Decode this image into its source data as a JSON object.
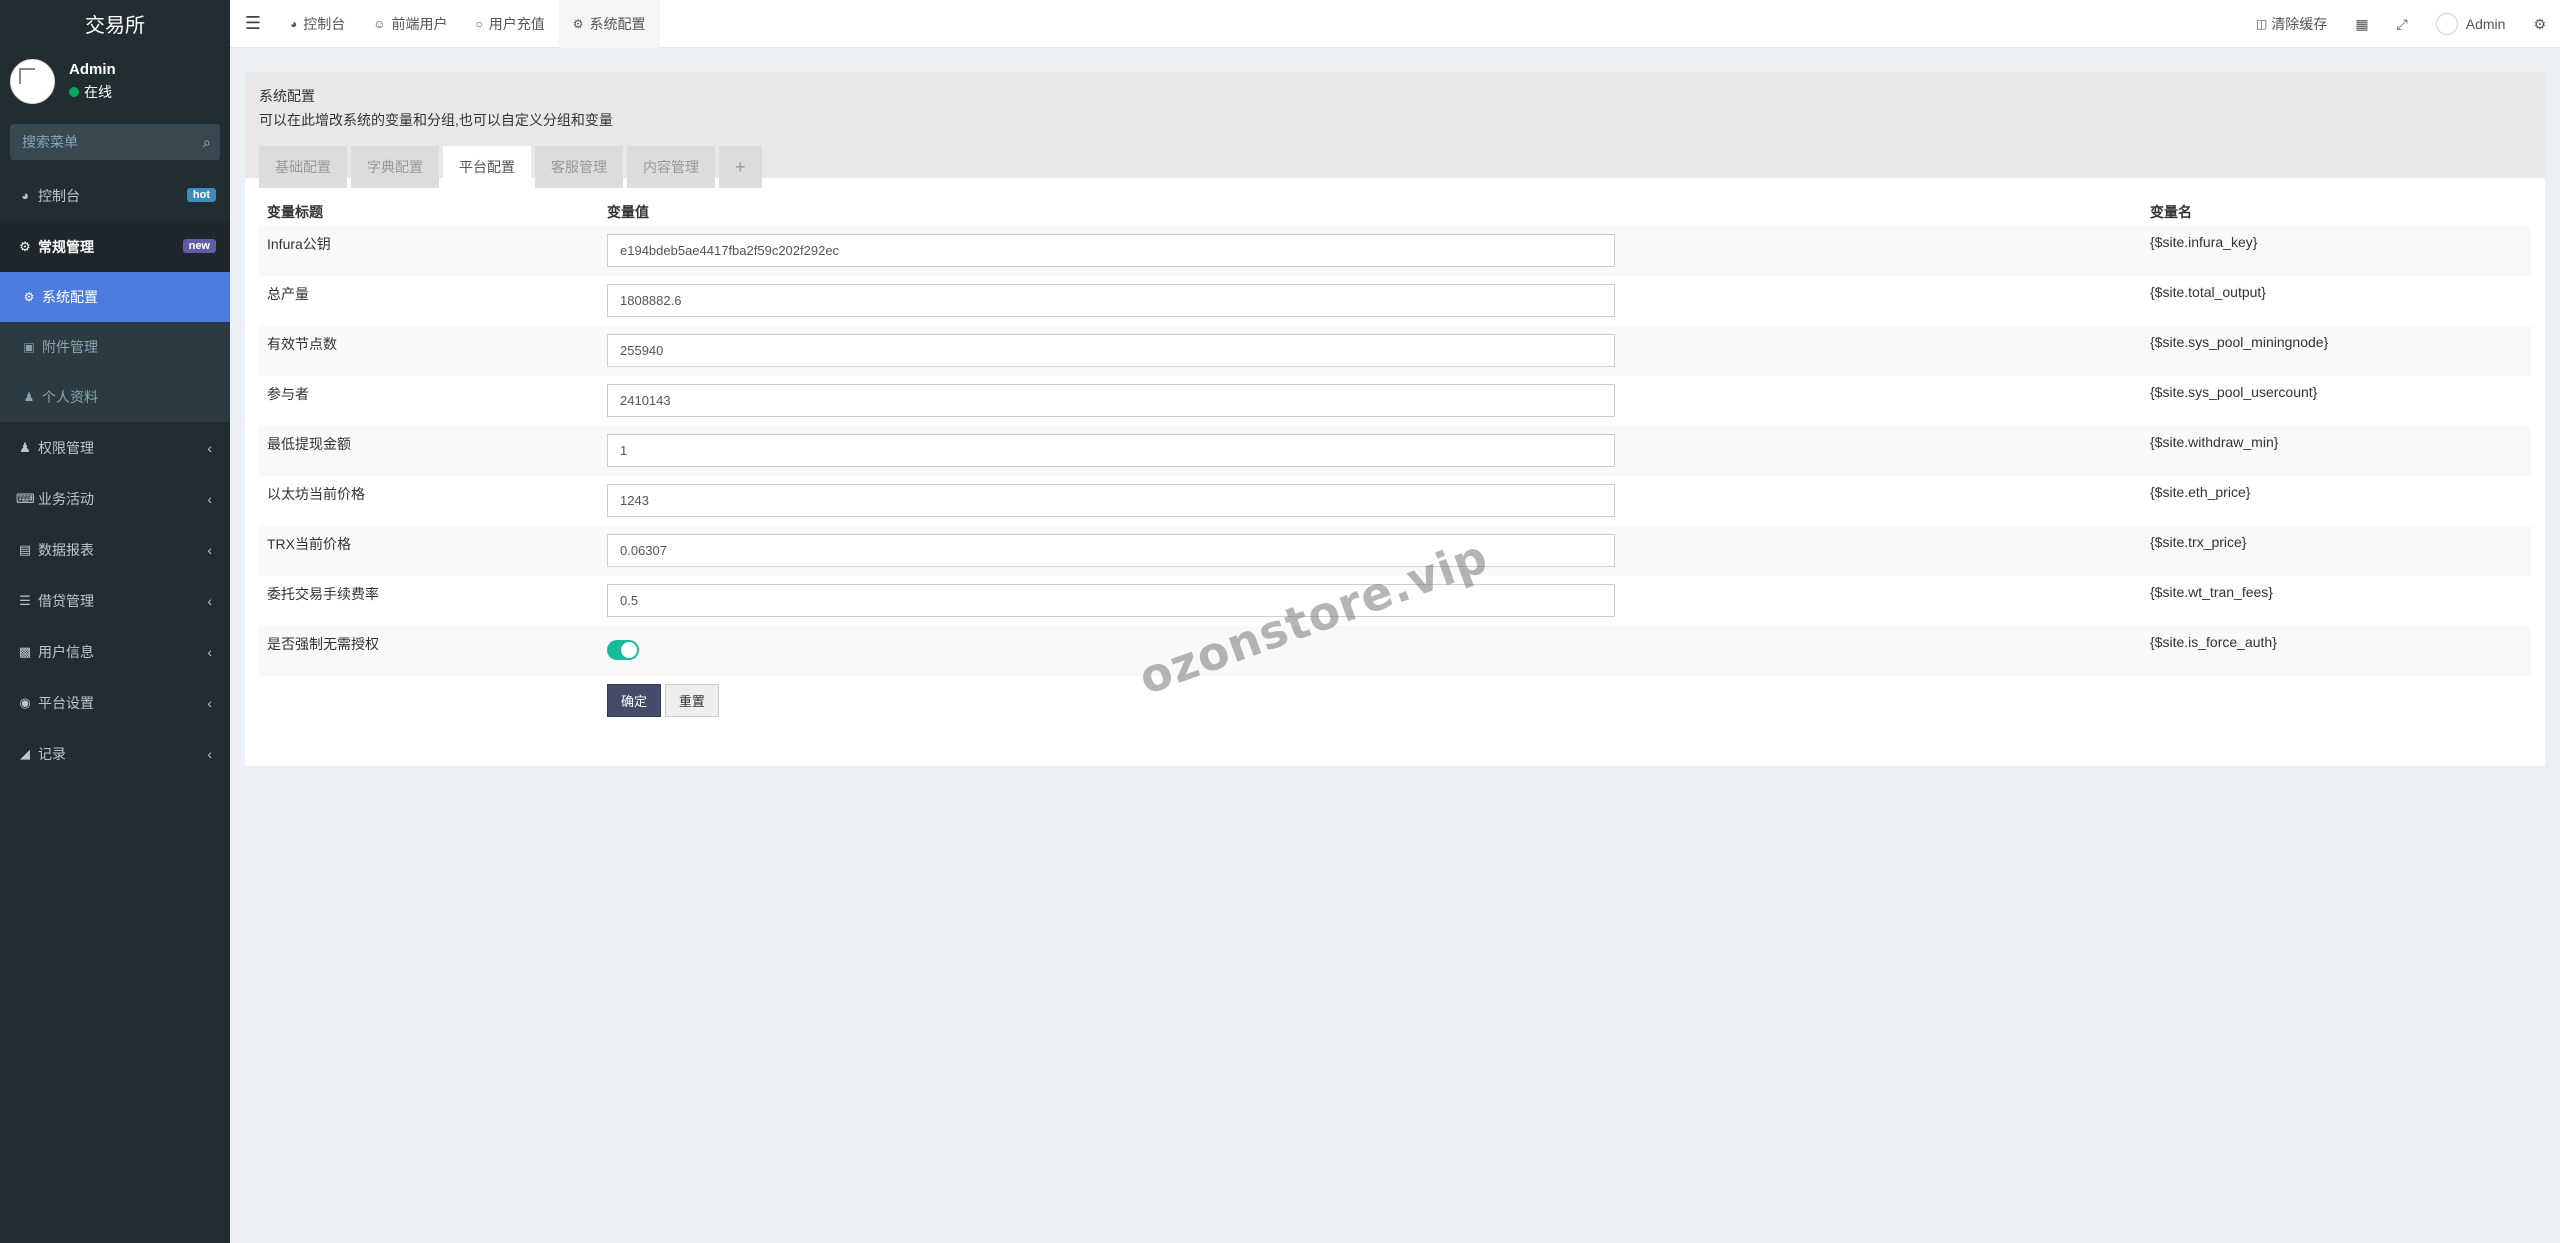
{
  "sidebar": {
    "logo": "交易所",
    "user": {
      "name": "Admin",
      "status": "在线"
    },
    "search_placeholder": "搜索菜单",
    "nav": [
      {
        "label": "控制台",
        "badge": "hot",
        "icon": "dashboard-icon"
      },
      {
        "label": "常规管理",
        "badge": "new",
        "icon": "cogs-icon"
      },
      {
        "label": "权限管理",
        "icon": "group-icon"
      },
      {
        "label": "业务活动",
        "icon": "keyboard-icon"
      },
      {
        "label": "数据报表",
        "icon": "file-icon"
      },
      {
        "label": "借贷管理",
        "icon": "list-icon"
      },
      {
        "label": "用户信息",
        "icon": "address-book-icon"
      },
      {
        "label": "平台设置",
        "icon": "settings-icon"
      },
      {
        "label": "记录",
        "icon": "area-chart-icon"
      }
    ],
    "sub_items": [
      {
        "label": "系统配置",
        "icon": "gear-icon"
      },
      {
        "label": "附件管理",
        "icon": "file-image-icon"
      },
      {
        "label": "个人资料",
        "icon": "user-icon"
      }
    ]
  },
  "topbar": {
    "tabs": [
      "控制台",
      "前端用户",
      "用户充值",
      "系统配置"
    ],
    "clear_cache": "清除缓存",
    "admin": "Admin"
  },
  "panel": {
    "title": "系统配置",
    "description": "可以在此增改系统的变量和分组,也可以自定义分组和变量",
    "tabs": [
      "基础配置",
      "字典配置",
      "平台配置",
      "客服管理",
      "内容管理",
      "+"
    ]
  },
  "table": {
    "headers": [
      "变量标题",
      "变量值",
      "变量名"
    ],
    "rows": [
      {
        "title": "Infura公钥",
        "value": "e194bdeb5ae4417fba2f59c202f292ec",
        "name": "{$site.infura_key}"
      },
      {
        "title": "总产量",
        "value": "1808882.6",
        "name": "{$site.total_output}"
      },
      {
        "title": "有效节点数",
        "value": "255940",
        "name": "{$site.sys_pool_miningnode}"
      },
      {
        "title": "参与者",
        "value": "2410143",
        "name": "{$site.sys_pool_usercount}"
      },
      {
        "title": "最低提现金额",
        "value": "1",
        "name": "{$site.withdraw_min}"
      },
      {
        "title": "以太坊当前价格",
        "value": "1243",
        "name": "{$site.eth_price}"
      },
      {
        "title": "TRX当前价格",
        "value": "0.06307",
        "name": "{$site.trx_price}"
      },
      {
        "title": "委托交易手续费率",
        "value": "0.5",
        "name": "{$site.wt_tran_fees}"
      },
      {
        "title": "是否强制无需授权",
        "name": "{$site.is_force_auth}"
      }
    ],
    "confirm_label": "确定",
    "reset_label": "重置"
  },
  "watermark": "ozonstore.vip",
  "colors": {
    "sidebar_bg": "#222d32",
    "active_blue": "#4c7cde",
    "toggle_on": "#18bc9c",
    "primary_btn": "#444c69"
  }
}
